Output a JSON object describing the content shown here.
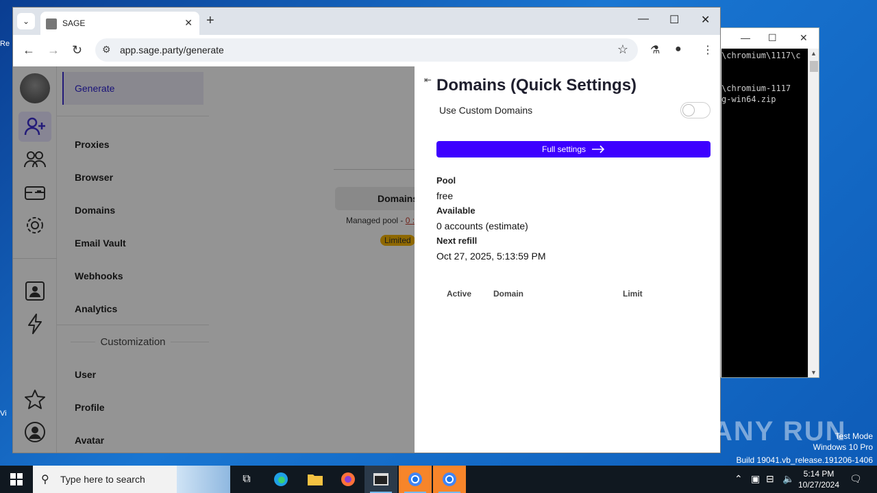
{
  "browser": {
    "tab_title": "SAGE",
    "url": "app.sage.party/generate"
  },
  "nav": {
    "active": "Generate",
    "items": [
      "Proxies",
      "Browser",
      "Domains",
      "Email Vault",
      "Webhooks",
      "Analytics"
    ],
    "section": "Customization",
    "custom_items": [
      "User",
      "Profile",
      "Avatar"
    ]
  },
  "main": {
    "pill": "Domains",
    "managed_text": "Managed pool - ",
    "managed_link": "0 :",
    "badge": "Limited"
  },
  "drawer": {
    "title": "Domains (Quick Settings)",
    "toggle_label": "Use Custom Domains",
    "full_settings": "Full settings",
    "pool_label": "Pool",
    "pool_value": "free",
    "available_label": "Available",
    "available_value": "0 accounts (estimate)",
    "refill_label": "Next refill",
    "refill_value": "Oct 27, 2025, 5:13:59 PM",
    "columns": [
      "Active",
      "Domain",
      "Limit"
    ]
  },
  "console": {
    "lines": [
      "\\chromium\\1117\\c",
      "",
      "",
      "\\chromium-1117",
      "g-win64.zip"
    ]
  },
  "watermark": {
    "brand": "ANY RUN",
    "mode": "Test Mode",
    "os": "Windows 10 Pro",
    "build": "Build 19041.vb_release.191206-1406"
  },
  "taskbar": {
    "search_placeholder": "Type here to search",
    "time": "5:14 PM",
    "date": "10/27/2024"
  },
  "colors": {
    "accent": "#3d00ff",
    "active_nav": "#2a1fcf",
    "badge": "#f4b400"
  }
}
